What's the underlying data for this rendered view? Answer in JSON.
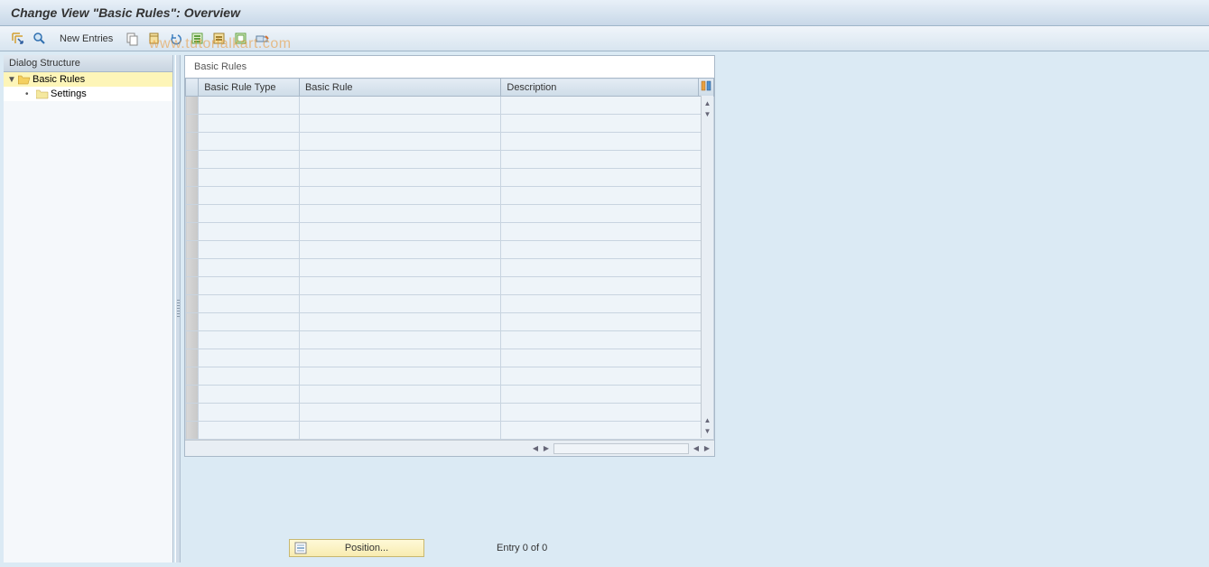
{
  "title": "Change View \"Basic Rules\": Overview",
  "toolbar": {
    "new_entries_label": "New Entries"
  },
  "watermark": "www.tutorialkart.com",
  "dialog_structure": {
    "header": "Dialog Structure",
    "items": [
      {
        "label": "Basic Rules",
        "selected": true,
        "open": true
      },
      {
        "label": "Settings",
        "selected": false,
        "open": false
      }
    ]
  },
  "table": {
    "title": "Basic Rules",
    "columns": [
      "Basic Rule Type",
      "Basic Rule",
      "Description"
    ],
    "row_count": 19
  },
  "footer": {
    "position_label": "Position...",
    "entry_text": "Entry 0 of 0"
  }
}
